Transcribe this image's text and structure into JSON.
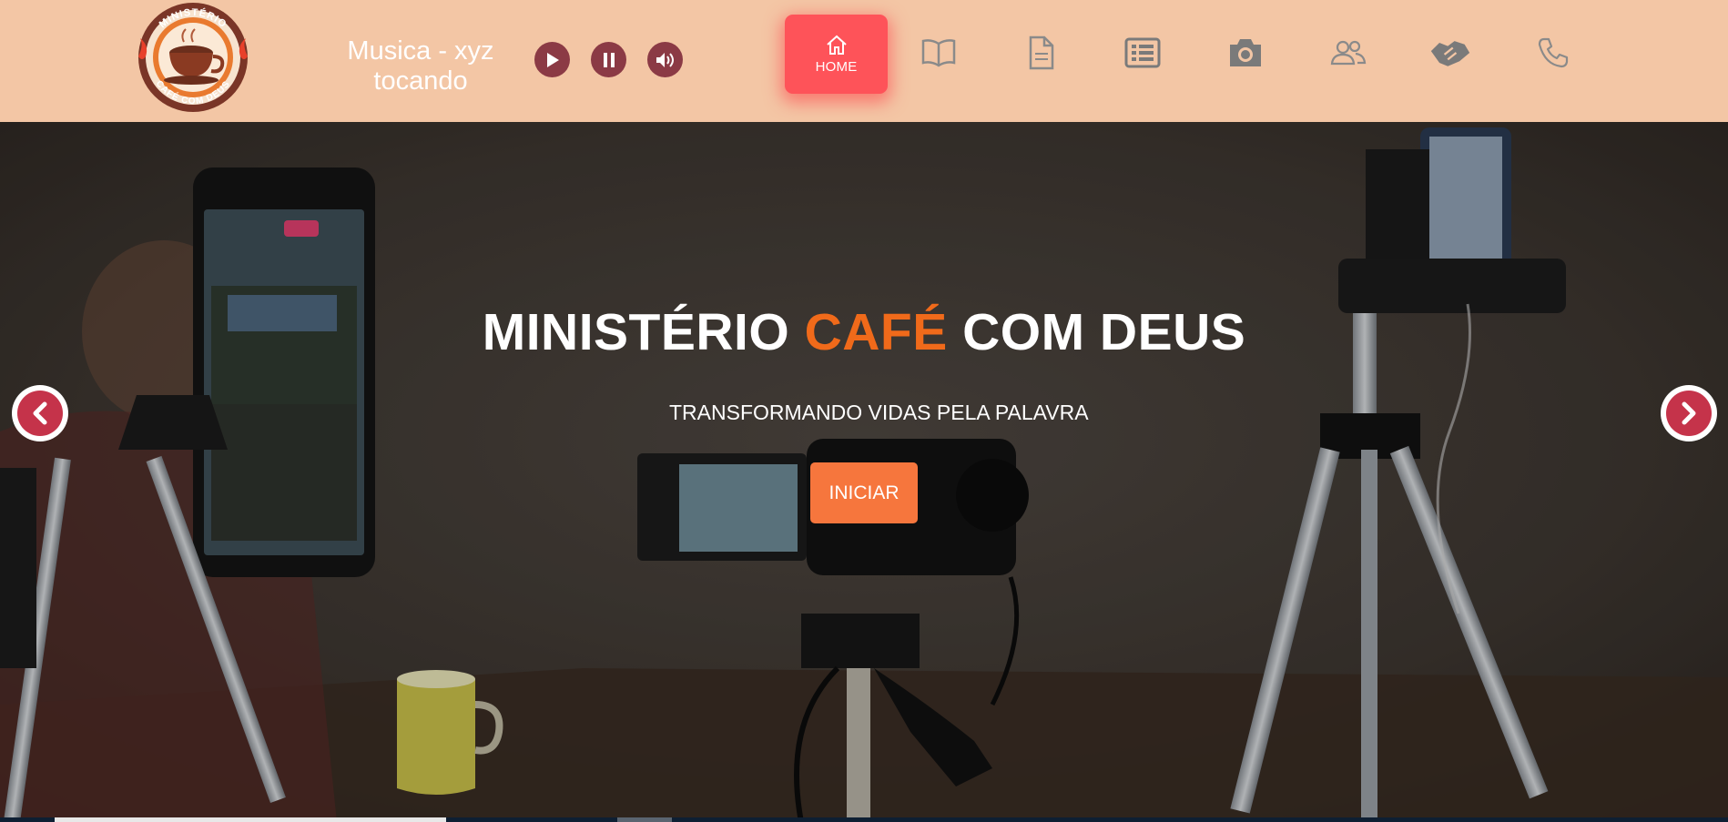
{
  "header": {
    "logo": {
      "top_text": "MINISTÉRIO",
      "bottom_text": "CAFÉ COM DEUS",
      "icon": "coffee-cup-logo"
    },
    "player": {
      "track_title": "Musica - xyz",
      "status": "tocando",
      "controls": [
        "play-icon",
        "pause-icon",
        "volume-icon"
      ]
    },
    "nav": {
      "home_label": "HOME",
      "items": [
        "home-icon",
        "book-icon",
        "document-icon",
        "list-icon",
        "camera-icon",
        "people-icon",
        "handshake-icon",
        "phone-icon"
      ]
    }
  },
  "hero": {
    "title_part1": "MINISTÉRIO ",
    "title_accent": "CAFÉ",
    "title_part2": " COM DEUS",
    "subtitle": "TRANSFORMANDO VIDAS PELA PALAVRA",
    "cta_label": "INICIAR",
    "prev_icon": "chevron-left-icon",
    "next_icon": "chevron-right-icon"
  },
  "colors": {
    "header_bg": "#f3c6a5",
    "accent_orange": "#f06a1a",
    "cta_bg": "#f6763d",
    "home_active": "#fe5359",
    "player_btn": "#8b3a45",
    "arrow_red": "#c5334a",
    "nav_icon_gray": "#8a8a8a"
  }
}
